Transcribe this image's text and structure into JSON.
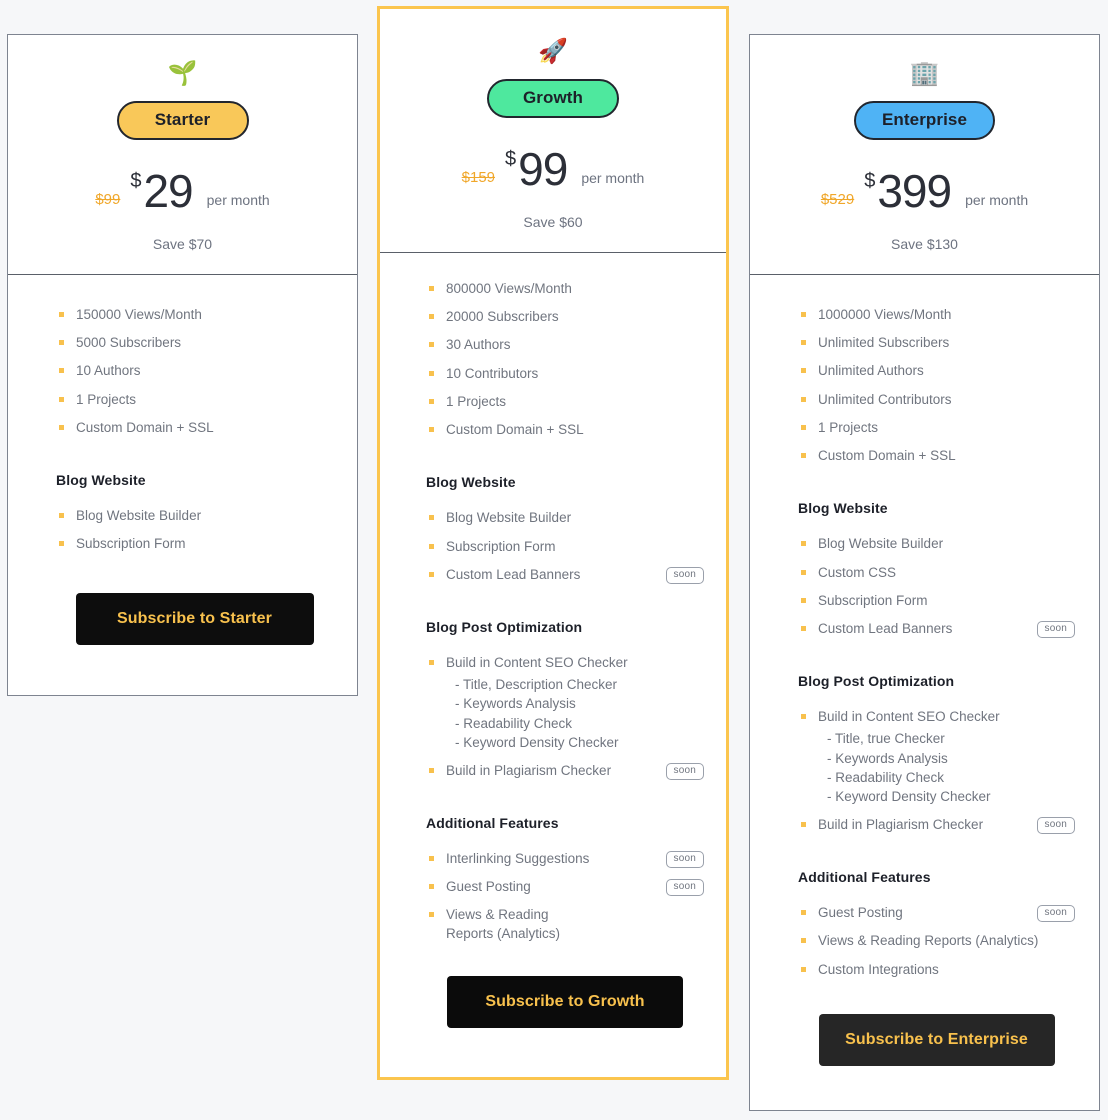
{
  "background_color": "#f6f7f9",
  "accent_colors": {
    "bullet": "#f8c14d",
    "old_price": "#f0a72a",
    "starter_pill": "#f9c859",
    "growth_pill": "#4ee89e",
    "enterprise_pill": "#4fb3f5",
    "growth_card_border": "#fbc54e",
    "cta_background": "#0d0d0d",
    "cta_text": "#f8c14d"
  },
  "plans": [
    {
      "id": "starter",
      "icon": "seedling-icon",
      "icon_glyph": "🌱",
      "name": "Starter",
      "old_price": "$99",
      "currency": "$",
      "price": "29",
      "period": "per month",
      "save": "Save $70",
      "cta_label": "Subscribe to Starter",
      "groups": [
        {
          "title": "",
          "items": [
            {
              "text": "150000 Views/Month",
              "soon": false
            },
            {
              "text": "5000 Subscribers",
              "soon": false
            },
            {
              "text": "10 Authors",
              "soon": false
            },
            {
              "text": "1 Projects",
              "soon": false
            },
            {
              "text": "Custom Domain + SSL",
              "soon": false
            }
          ]
        },
        {
          "title": "Blog Website",
          "items": [
            {
              "text": "Blog Website Builder",
              "soon": false
            },
            {
              "text": "Subscription Form",
              "soon": false
            }
          ]
        }
      ]
    },
    {
      "id": "growth",
      "icon": "rocket-icon",
      "icon_glyph": "🚀",
      "name": "Growth",
      "old_price": "$159",
      "currency": "$",
      "price": "99",
      "period": "per month",
      "save": "Save $60",
      "cta_label": "Subscribe to Growth",
      "groups": [
        {
          "title": "",
          "items": [
            {
              "text": "800000 Views/Month",
              "soon": false
            },
            {
              "text": "20000 Subscribers",
              "soon": false
            },
            {
              "text": "30 Authors",
              "soon": false
            },
            {
              "text": "10 Contributors",
              "soon": false
            },
            {
              "text": "1 Projects",
              "soon": false
            },
            {
              "text": "Custom Domain + SSL",
              "soon": false
            }
          ]
        },
        {
          "title": "Blog Website",
          "items": [
            {
              "text": "Blog Website Builder",
              "soon": false
            },
            {
              "text": "Subscription Form",
              "soon": false
            },
            {
              "text": "Custom Lead Banners",
              "soon": true,
              "soon_label": "soon"
            }
          ]
        },
        {
          "title": "Blog Post Optimization",
          "items": [
            {
              "text": "Build in Content SEO Checker",
              "soon": false,
              "sub": [
                "- Title, Description Checker",
                "- Keywords Analysis",
                "- Readability Check",
                "- Keyword Density Checker"
              ]
            },
            {
              "text": "Build in Plagiarism Checker",
              "soon": true,
              "soon_label": "soon"
            }
          ]
        },
        {
          "title": "Additional Features",
          "items": [
            {
              "text": "Interlinking Suggestions",
              "soon": true,
              "soon_label": "soon"
            },
            {
              "text": "Guest Posting",
              "soon": true,
              "soon_label": "soon"
            },
            {
              "text": "Views & Reading Reports (Analytics)",
              "soon": false
            }
          ]
        }
      ]
    },
    {
      "id": "enterprise",
      "icon": "office-building-icon",
      "icon_glyph": "🏢",
      "name": "Enterprise",
      "old_price": "$529",
      "currency": "$",
      "price": "399",
      "period": "per month",
      "save": "Save $130",
      "cta_label": "Subscribe to Enterprise",
      "groups": [
        {
          "title": "",
          "items": [
            {
              "text": "1000000 Views/Month",
              "soon": false
            },
            {
              "text": "Unlimited Subscribers",
              "soon": false
            },
            {
              "text": "Unlimited Authors",
              "soon": false
            },
            {
              "text": "Unlimited Contributors",
              "soon": false
            },
            {
              "text": "1 Projects",
              "soon": false
            },
            {
              "text": "Custom Domain + SSL",
              "soon": false
            }
          ]
        },
        {
          "title": "Blog Website",
          "items": [
            {
              "text": "Blog Website Builder",
              "soon": false
            },
            {
              "text": "Custom CSS",
              "soon": false
            },
            {
              "text": "Subscription Form",
              "soon": false
            },
            {
              "text": "Custom Lead Banners",
              "soon": true,
              "soon_label": "soon"
            }
          ]
        },
        {
          "title": "Blog Post Optimization",
          "items": [
            {
              "text": "Build in Content SEO Checker",
              "soon": false,
              "sub": [
                "- Title, true Checker",
                "- Keywords Analysis",
                "- Readability Check",
                "- Keyword Density Checker"
              ]
            },
            {
              "text": "Build in Plagiarism Checker",
              "soon": true,
              "soon_label": "soon"
            }
          ]
        },
        {
          "title": "Additional Features",
          "items": [
            {
              "text": "Guest Posting",
              "soon": true,
              "soon_label": "soon"
            },
            {
              "text": "Views & Reading Reports (Analytics)",
              "soon": false
            },
            {
              "text": "Custom Integrations",
              "soon": false
            }
          ]
        }
      ]
    }
  ]
}
